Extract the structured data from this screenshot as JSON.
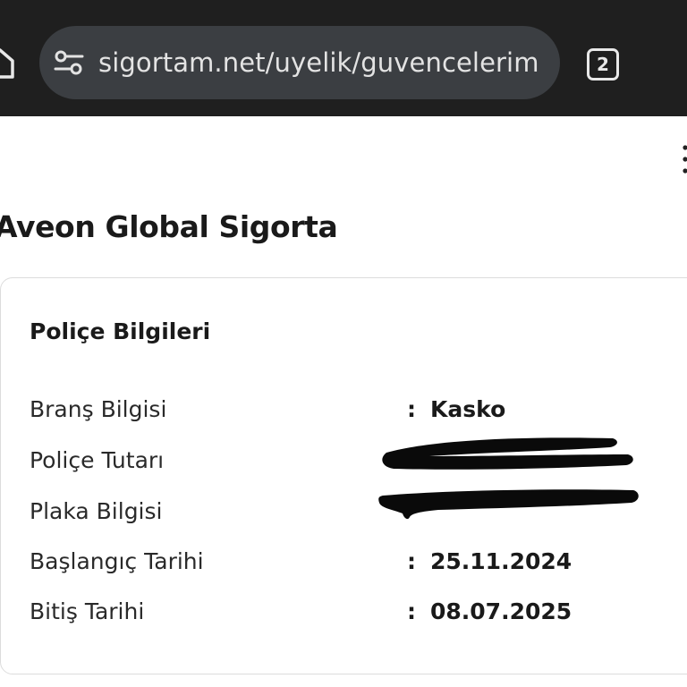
{
  "browser": {
    "url": "sigortam.net/uyelik/guvencelerim",
    "tab_count": "2",
    "icons": [
      "home-icon",
      "site-settings-icon",
      "tab-switcher-icon",
      "overflow-menu-icon"
    ]
  },
  "page": {
    "company_name": "Aveon Global Sigorta"
  },
  "policy_card": {
    "title": "Poliçe Bilgileri",
    "rows": [
      {
        "label": "Branş Bilgisi",
        "colon": ":",
        "value": "Kasko"
      },
      {
        "label": "Poliçe Tutarı",
        "colon": "",
        "value": ""
      },
      {
        "label": "Plaka Bilgisi",
        "colon": "",
        "value": ""
      },
      {
        "label": "Başlangıç Tarihi",
        "colon": ":",
        "value": "25.11.2024"
      },
      {
        "label": "Bitiş Tarihi",
        "colon": ":",
        "value": "08.07.2025"
      }
    ]
  },
  "colors": {
    "browser_bar": "#1f1f1f",
    "url_field": "#3b3e42",
    "text_primary": "#1a1a1a",
    "redaction": "#0a0a0a"
  }
}
